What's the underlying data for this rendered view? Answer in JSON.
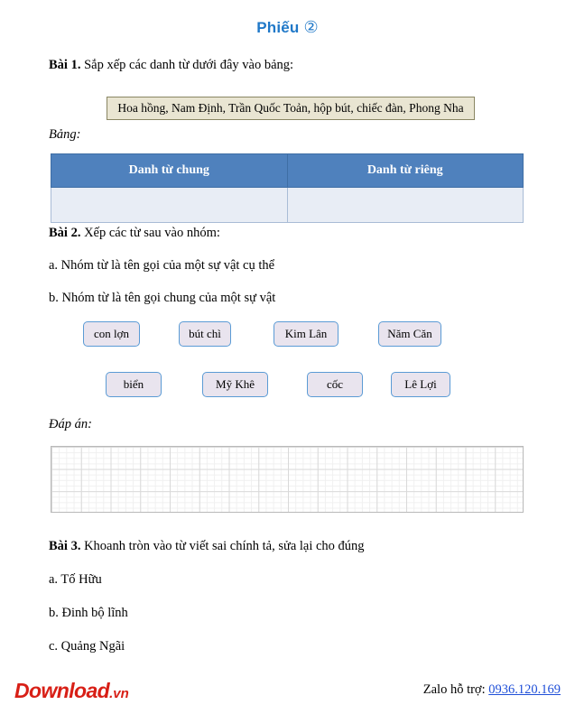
{
  "document": {
    "title_text": "Phiếu",
    "title_number": "②"
  },
  "exercise1": {
    "heading_label": "Bài 1.",
    "heading_text": " Sắp xếp các danh từ dưới đây vào bảng:",
    "wordbank": "Hoa hồng, Nam Định, Trần Quốc Toản, hộp bút, chiếc đàn, Phong Nha",
    "table_label": "Bảng:",
    "table": {
      "headers": [
        "Danh từ chung",
        "Danh từ riêng"
      ],
      "rows": [
        [
          "",
          ""
        ]
      ]
    }
  },
  "exercise2": {
    "heading_label": "Bài 2.",
    "heading_text": " Xếp các từ sau vào nhóm:",
    "option_a": "a. Nhóm từ là tên gọi của một sự vật cụ thể",
    "option_b": "b. Nhóm từ là tên gọi chung của một sự vật",
    "chips_row1": [
      "con lợn",
      "bút chì",
      "Kim Lân",
      "Năm Căn"
    ],
    "chips_row2": [
      "biển",
      "Mỹ Khê",
      "cốc",
      "Lê Lợi"
    ],
    "answer_label": "Đáp án:"
  },
  "exercise3": {
    "heading_label": "Bài 3.",
    "heading_text": " Khoanh tròn vào từ viết sai chính tả, sửa lại cho đúng",
    "item_a": "a. Tố Hữu",
    "item_b": "b. Đinh bộ lĩnh",
    "item_c": "c. Quảng Ngãi"
  },
  "footer": {
    "logo_main": "Download",
    "logo_suffix": ".vn",
    "zalo_label": "Zalo hỗ trợ: ",
    "zalo_phone": "0936.120.169"
  },
  "colors": {
    "title_blue": "#1f78c8",
    "table_header_blue": "#4f81bd",
    "table_row_blue": "#e8edf5",
    "wordbank_beige": "#e9e5d2",
    "chip_fill": "#e9e4ee",
    "chip_border": "#5b9bd5",
    "logo_red": "#d81f16",
    "link_blue": "#1f4fd8"
  }
}
